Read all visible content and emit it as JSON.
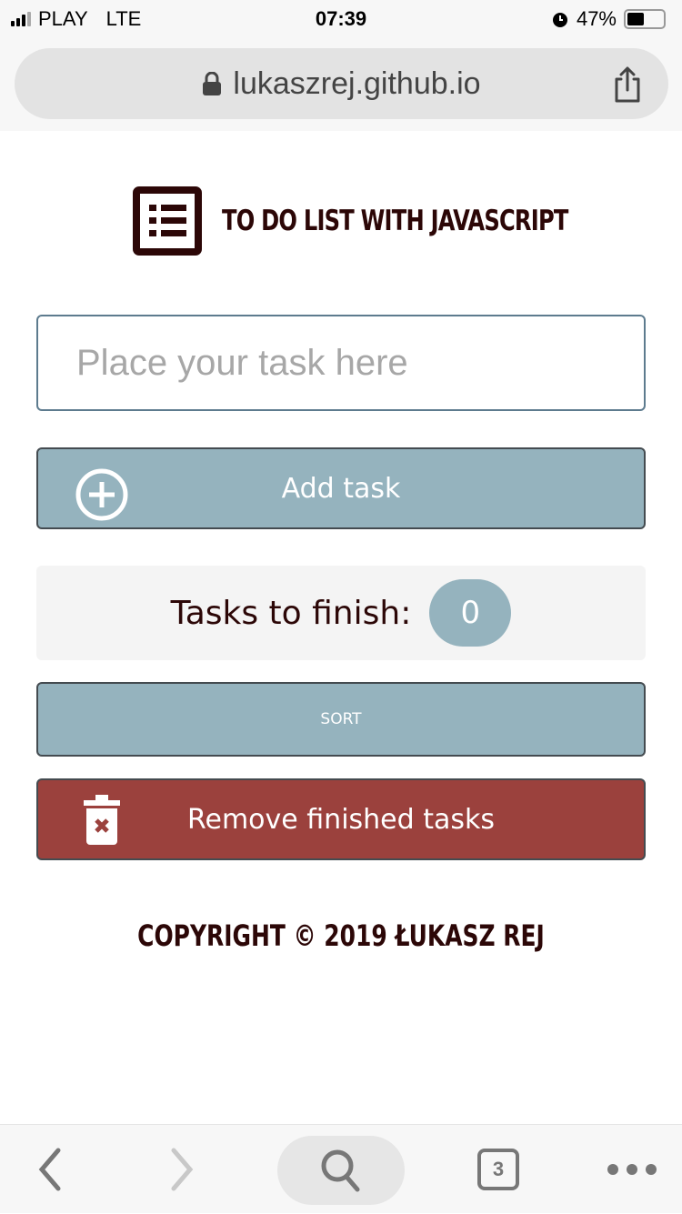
{
  "status": {
    "carrier": "PLAY",
    "network": "LTE",
    "time": "07:39",
    "battery": "47%",
    "battery_level": 0.47
  },
  "browser": {
    "url": "lukaszrej.github.io",
    "tabs_count": "3"
  },
  "app": {
    "title": "TO DO LIST WITH JAVASCRIPT",
    "input_placeholder": "Place your task here",
    "input_value": "",
    "add_label": "Add task",
    "counter_label": "Tasks to finish:",
    "counter_value": "0",
    "sort_label": "SORT",
    "remove_label": "Remove finished tasks",
    "footer": "COPYRIGHT © 2019 ŁUKASZ REJ"
  },
  "colors": {
    "accent": "#95b3be",
    "danger": "#9b413d",
    "text": "#2c0707"
  }
}
